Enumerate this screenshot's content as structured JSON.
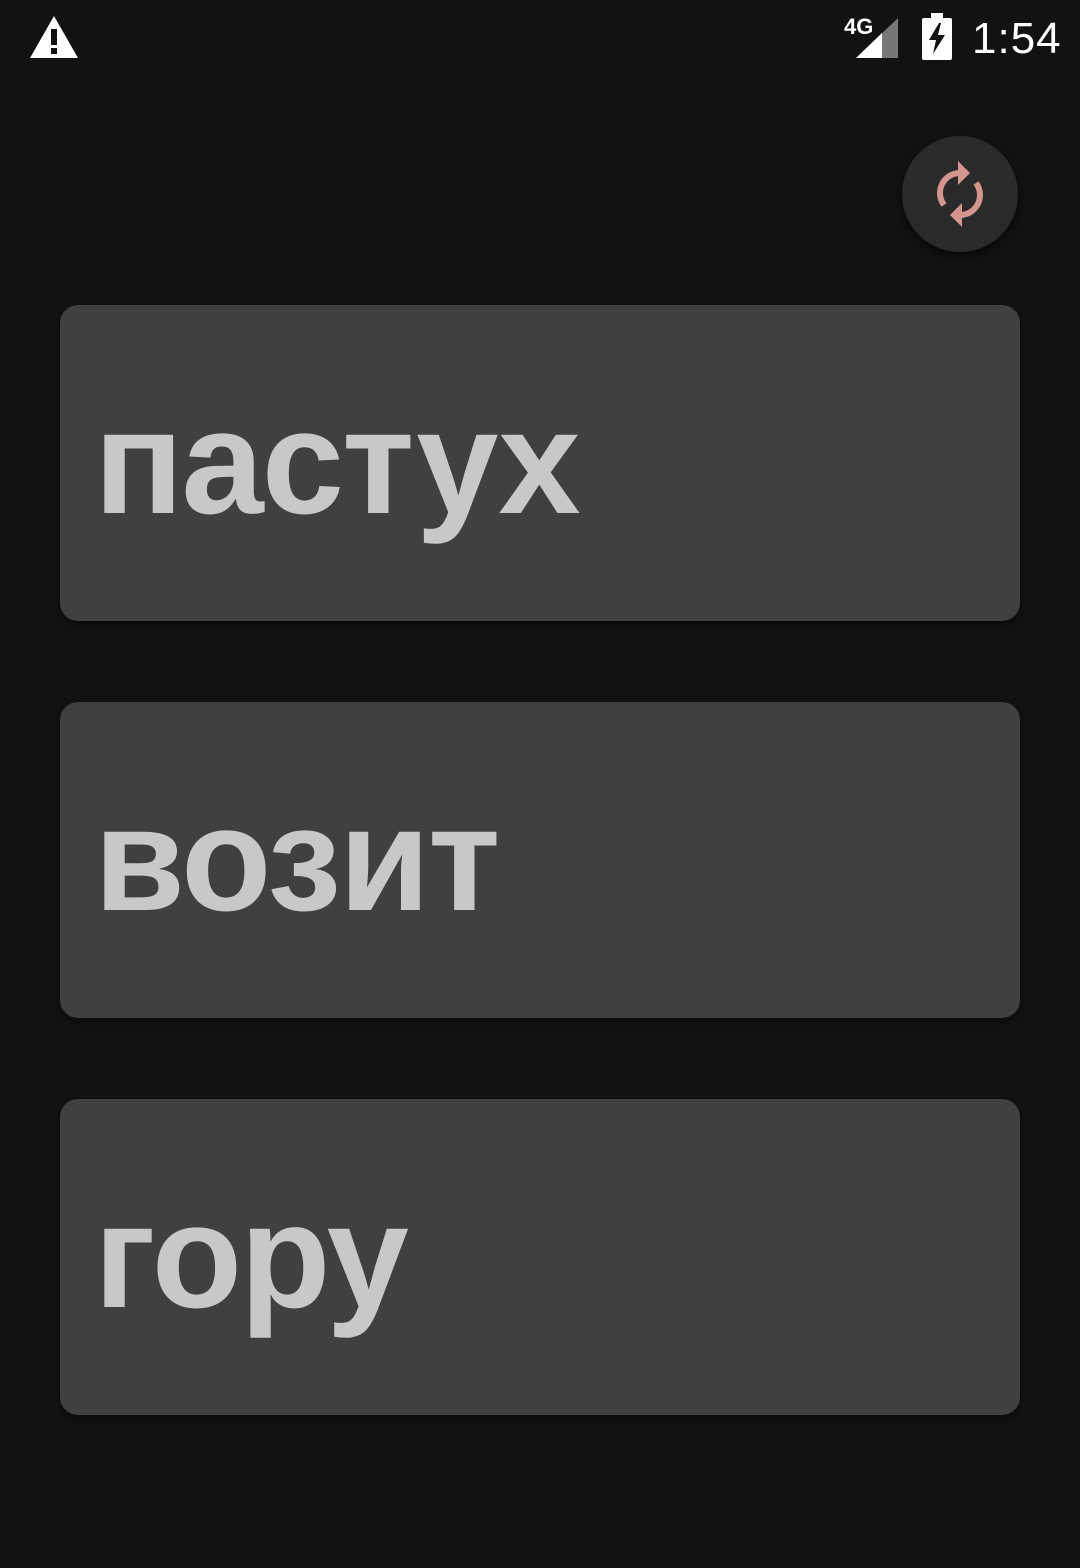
{
  "status_bar": {
    "time": "1:54",
    "network_type": "4G",
    "icons": [
      "warning-icon",
      "signal-icon",
      "battery-charging-icon"
    ]
  },
  "refresh_button": {
    "icon": "refresh-icon",
    "color": "#d4958f"
  },
  "cards": [
    {
      "word": "пастух"
    },
    {
      "word": "возит"
    },
    {
      "word": "гору"
    }
  ],
  "colors": {
    "background": "#121212",
    "card": "#404040",
    "text": "#c8c8c8"
  }
}
